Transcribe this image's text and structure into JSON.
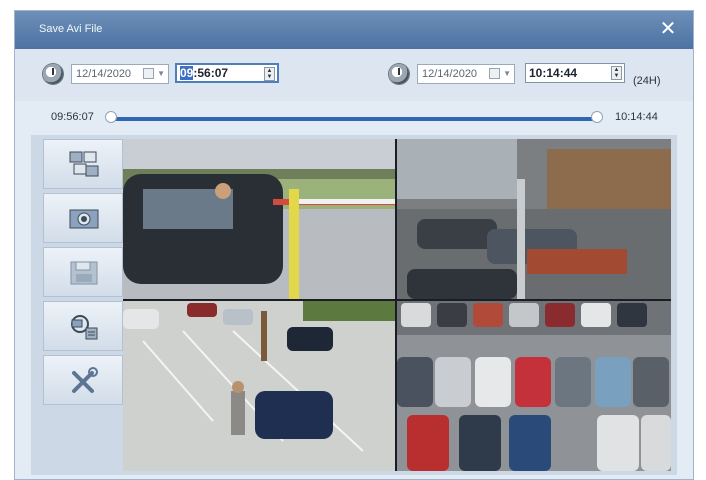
{
  "dialog": {
    "title": "Save Avi File",
    "close_symbol": "✕"
  },
  "start": {
    "date": "12/14/2020",
    "time_hour": "09",
    "time_rest": ":56:07"
  },
  "end": {
    "date": "12/14/2020",
    "time": "10:14:44",
    "mode": "(24H)"
  },
  "slider": {
    "start_label": "09:56:07",
    "end_label": "10:14:44"
  },
  "toolbar": {
    "items": [
      {
        "name": "split-screen-icon"
      },
      {
        "name": "snapshot-icon"
      },
      {
        "name": "save-icon"
      },
      {
        "name": "search-camera-icon"
      },
      {
        "name": "tools-icon"
      }
    ]
  },
  "colors": {
    "titlebar": "#5a7eab",
    "slider": "#2f67b2",
    "accent": "#4d7fbf"
  },
  "cameras": [
    {
      "name": "camera-1-parking-gate"
    },
    {
      "name": "camera-2-construction-yard"
    },
    {
      "name": "camera-3-parking-lot"
    },
    {
      "name": "camera-4-parked-cars"
    }
  ]
}
